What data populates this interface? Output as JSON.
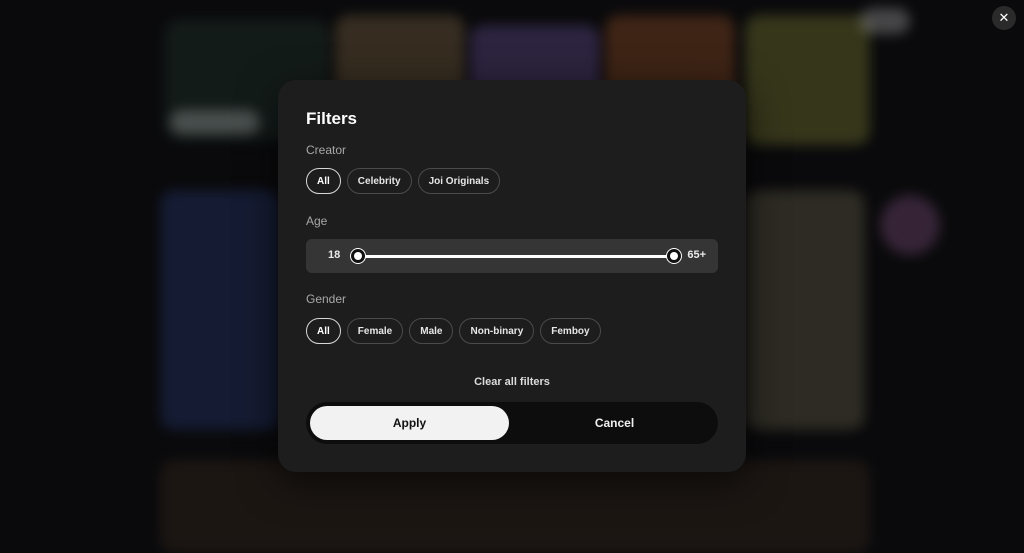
{
  "close_icon_glyph": "✕",
  "filters": {
    "title": "Filters",
    "creator": {
      "label": "Creator",
      "options": [
        "All",
        "Celebrity",
        "Joi Originals"
      ],
      "selected": "All"
    },
    "age": {
      "label": "Age",
      "min_label": "18",
      "max_label": "65+",
      "range": [
        18,
        65
      ],
      "selected_min": 18,
      "selected_max": 65
    },
    "gender": {
      "label": "Gender",
      "options": [
        "All",
        "Female",
        "Male",
        "Non-binary",
        "Femboy"
      ],
      "selected": "All"
    },
    "clear_label": "Clear all filters",
    "apply_label": "Apply",
    "cancel_label": "Cancel"
  },
  "colors": {
    "modal_bg": "#1d1d1d",
    "apply_bg": "#f2f2f2",
    "cancel_bg": "#0d0d0d"
  }
}
